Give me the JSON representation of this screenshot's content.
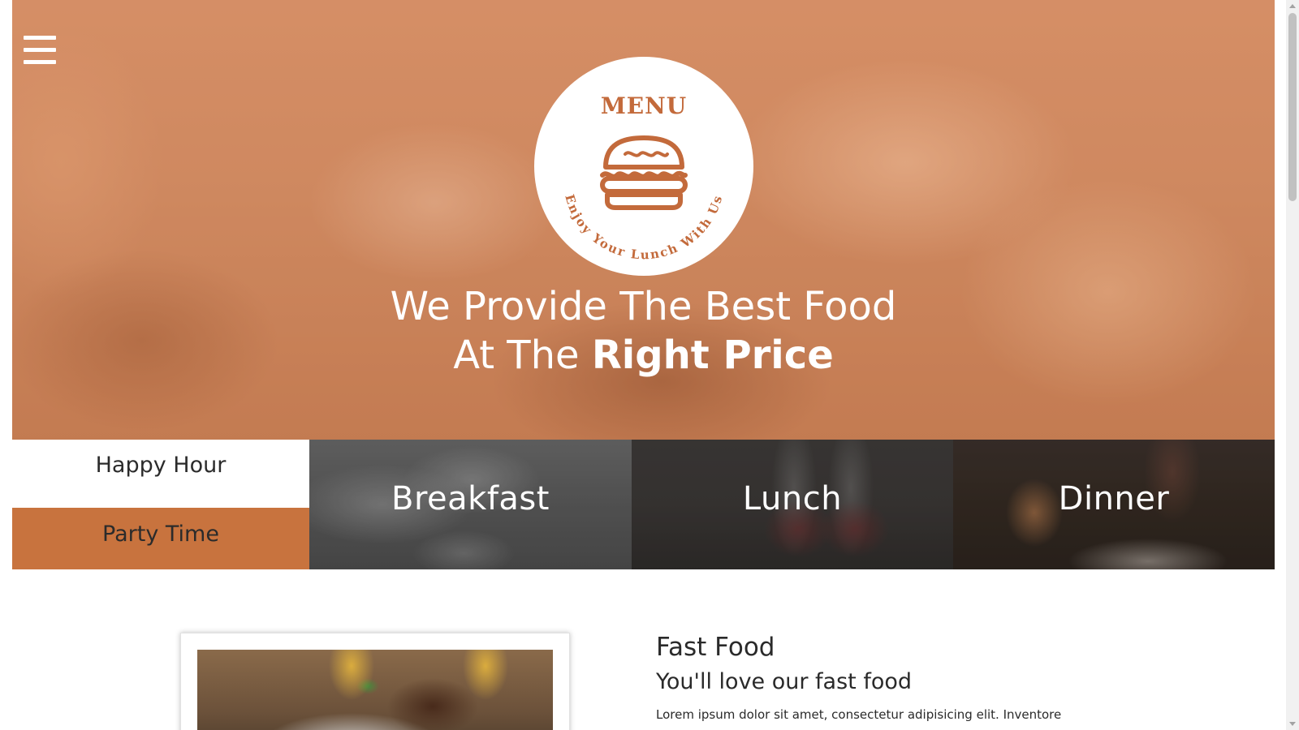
{
  "hero": {
    "logo": {
      "title": "MENU",
      "tagline": "Enjoy Your Lunch With Us",
      "icon": "burger-icon",
      "color": "#c36a3b"
    },
    "headline_line1": "We Provide The Best Food",
    "headline_line2_prefix": "At The ",
    "headline_line2_bold": "Right Price"
  },
  "nav": {
    "menu_icon": "hamburger-icon"
  },
  "tiles": {
    "happy_hour": "Happy Hour",
    "party_time": "Party Time",
    "breakfast": "Breakfast",
    "lunch": "Lunch",
    "dinner": "Dinner",
    "accent_color": "#c8733e"
  },
  "section": {
    "title": "Fast Food",
    "subtitle": "You'll love our fast food",
    "body": "Lorem ipsum dolor sit amet, consectetur adipisicing elit. Inventore"
  }
}
